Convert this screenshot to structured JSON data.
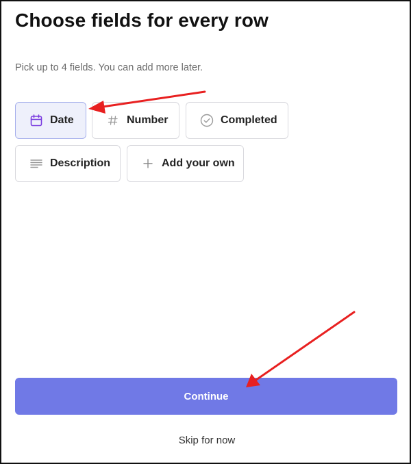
{
  "page": {
    "title": "Choose fields for every row",
    "subtitle": "Pick up to 4 fields. You can add more later."
  },
  "fields": [
    {
      "label": "Date",
      "icon": "calendar-icon",
      "selected": true
    },
    {
      "label": "Number",
      "icon": "hash-icon",
      "selected": false
    },
    {
      "label": "Completed",
      "icon": "check-circle-icon",
      "selected": false
    },
    {
      "label": "Description",
      "icon": "text-lines-icon",
      "selected": false
    },
    {
      "label": "Add your own",
      "icon": "plus-icon",
      "selected": false
    }
  ],
  "actions": {
    "continue_label": "Continue",
    "skip_label": "Skip for now"
  },
  "colors": {
    "accent": "#7079e6",
    "selected_icon": "#7a3ce0",
    "annotation_arrow": "#e82020"
  }
}
